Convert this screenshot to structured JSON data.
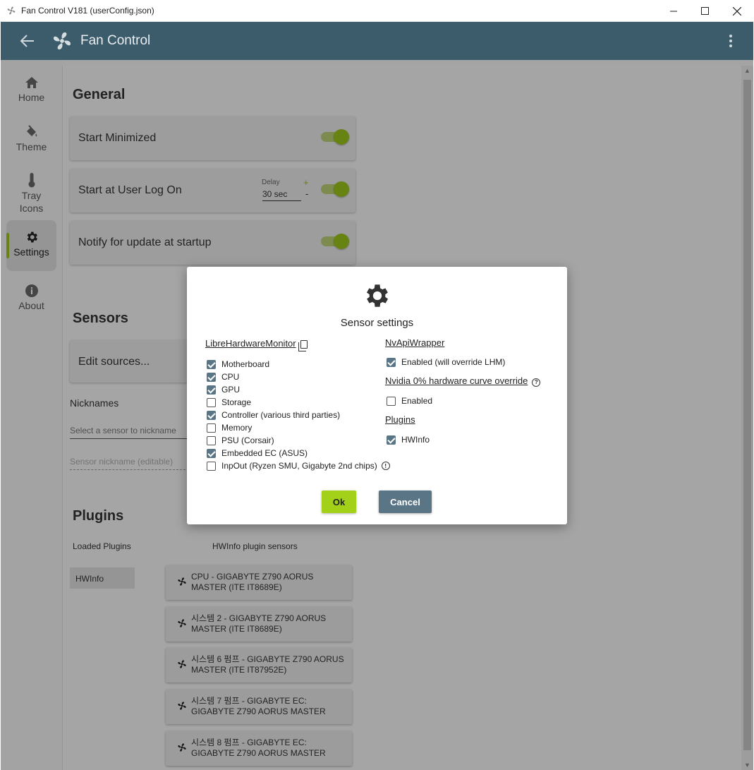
{
  "window": {
    "title": "Fan Control V181 (userConfig.json)"
  },
  "appbar": {
    "app_name": "Fan Control"
  },
  "sidebar": {
    "items": [
      {
        "label": "Home",
        "icon": "home-icon"
      },
      {
        "label": "Theme",
        "icon": "paint-bucket-icon"
      },
      {
        "label": "Tray Icons",
        "icon": "thermometer-icon"
      },
      {
        "label": "Settings",
        "icon": "gear-icon",
        "active": true
      },
      {
        "label": "About",
        "icon": "info-icon"
      }
    ]
  },
  "general": {
    "title": "General",
    "start_minimized": "Start Minimized",
    "start_at_logon": "Start at User Log On",
    "delay_label": "Delay",
    "delay_value": "30 sec",
    "delay_plus": "+",
    "delay_minus": "-",
    "notify_update": "Notify for update at startup"
  },
  "sensors": {
    "title": "Sensors",
    "edit_sources": "Edit sources...",
    "nicknames": "Nicknames",
    "select_placeholder": "Select a sensor to nickname",
    "nickname_placeholder": "Sensor nickname (editable)"
  },
  "plugins": {
    "title": "Plugins",
    "loaded_label": "Loaded Plugins",
    "sensors_label": "HWInfo plugin sensors",
    "loaded": [
      "HWInfo"
    ],
    "sensor_cards": [
      "CPU - GIGABYTE Z790 AORUS MASTER (ITE IT8689E)",
      "시스템 2 - GIGABYTE Z790 AORUS MASTER (ITE IT8689E)",
      "시스템 6 펌프 - GIGABYTE Z790 AORUS MASTER (ITE IT87952E)",
      "시스템 7 펌프 - GIGABYTE EC: GIGABYTE Z790 AORUS MASTER",
      "시스템 8 펌프 - GIGABYTE EC: GIGABYTE Z790 AORUS MASTER"
    ]
  },
  "dialog": {
    "title": "Sensor settings",
    "lhm_link": "LibreHardwareMonitor",
    "lhm_items": [
      {
        "label": "Motherboard",
        "checked": true
      },
      {
        "label": "CPU",
        "checked": true
      },
      {
        "label": "GPU",
        "checked": true
      },
      {
        "label": "Storage",
        "checked": false
      },
      {
        "label": "Controller (various third parties)",
        "checked": true
      },
      {
        "label": "Memory",
        "checked": false
      },
      {
        "label": "PSU (Corsair)",
        "checked": false
      },
      {
        "label": "Embedded EC (ASUS)",
        "checked": true
      },
      {
        "label": "InpOut (Ryzen SMU, Gigabyte 2nd chips)",
        "checked": false
      }
    ],
    "nvapi_link": "NvApiWrapper",
    "nvapi_enabled": "Enabled (will override LHM)",
    "nvidia_link": "Nvidia 0% hardware curve override",
    "nvidia_enabled": "Enabled",
    "plugins_link": "Plugins",
    "plugins_hwinfo": "HWInfo",
    "ok": "Ok",
    "cancel": "Cancel"
  },
  "colors": {
    "accent_green": "#98c11a",
    "header_bg": "#3d5c6b",
    "cancel_bg": "#5a7686"
  }
}
